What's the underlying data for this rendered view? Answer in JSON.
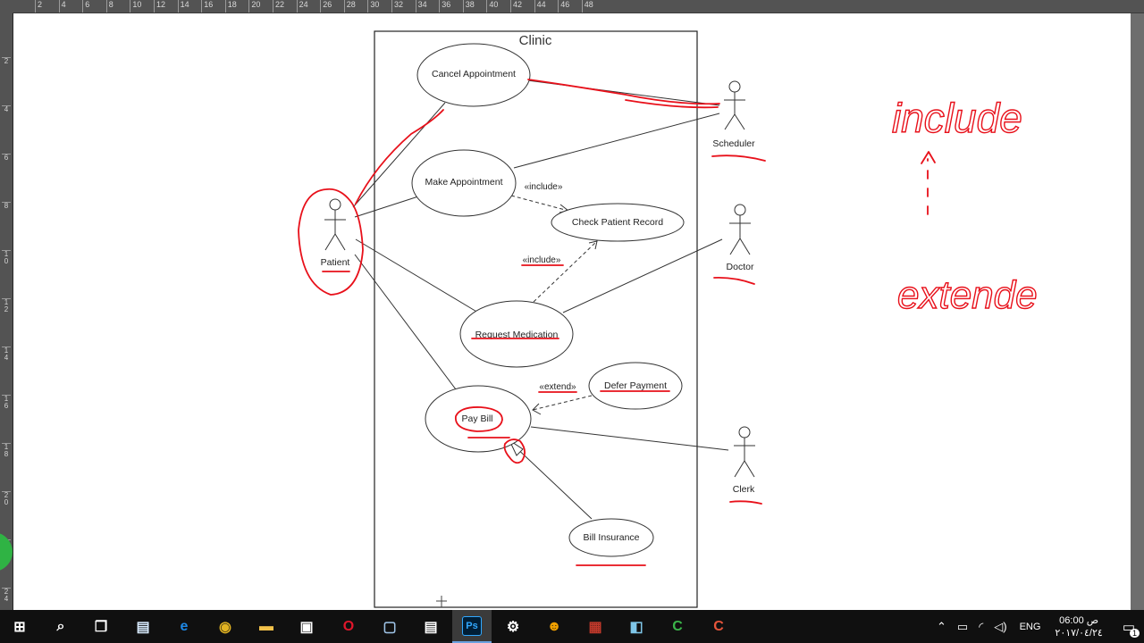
{
  "ruler": {
    "top_ticks": [
      "2",
      "4",
      "6",
      "8",
      "10",
      "12",
      "14",
      "16",
      "18",
      "20",
      "22",
      "24",
      "26",
      "28",
      "30",
      "32",
      "34",
      "36",
      "38",
      "40",
      "42",
      "44",
      "46",
      "48"
    ],
    "left_ticks": [
      "2",
      "4",
      "6",
      "8",
      "1 0",
      "1 2",
      "1 4",
      "1 6",
      "1 8",
      "2 0",
      "2 2",
      "2 4"
    ]
  },
  "diagram": {
    "system_label": "Clinic",
    "actors": {
      "scheduler": "Scheduler",
      "patient": "Patient",
      "doctor": "Doctor",
      "clerk": "Clerk"
    },
    "use_cases": {
      "cancel_appointment": "Cancel Appointment",
      "make_appointment": "Make Appointment",
      "check_patient_record": "Check Patient Record",
      "request_medication": "Request Medication",
      "defer_payment": "Defer Payment",
      "pay_bill": "Pay Bill",
      "bill_insurance": "Bill Insurance"
    },
    "stereotypes": {
      "include_top": "«include»",
      "include_bottom": "«include»",
      "extend": "«extend»"
    }
  },
  "annotations": {
    "word_top": "include",
    "word_bottom": "extende",
    "ink_color": "#e8101a"
  },
  "taskbar": {
    "apps": [
      {
        "icon": "windows-start-icon",
        "glyph": "⊞",
        "color": "#ffffff"
      },
      {
        "icon": "search-icon",
        "glyph": "⌕",
        "color": "#ffffff"
      },
      {
        "icon": "task-view-icon",
        "glyph": "❐",
        "color": "#ffffff"
      },
      {
        "icon": "notepad-icon",
        "glyph": "▤",
        "color": "#d9ecff"
      },
      {
        "icon": "edge-icon",
        "glyph": "e",
        "color": "#1e88e5"
      },
      {
        "icon": "chrome-icon",
        "glyph": "◉",
        "color": "#e3b422"
      },
      {
        "icon": "file-explorer-icon",
        "glyph": "▬",
        "color": "#f3c24a"
      },
      {
        "icon": "store-icon",
        "glyph": "▣",
        "color": "#ffffff"
      },
      {
        "icon": "opera-icon",
        "glyph": "O",
        "color": "#e0162b"
      },
      {
        "icon": "app-window-icon",
        "glyph": "▢",
        "color": "#9ec3e6"
      },
      {
        "icon": "document-viewer-icon",
        "glyph": "▤",
        "color": "#ffffff"
      },
      {
        "icon": "photoshop-icon",
        "glyph": "Ps",
        "color": "#31a8ff"
      },
      {
        "icon": "settings-icon",
        "glyph": "⚙",
        "color": "#ffffff"
      },
      {
        "icon": "avatar-app-icon",
        "glyph": "☻",
        "color": "#f0a000"
      },
      {
        "icon": "archive-icon",
        "glyph": "▦",
        "color": "#c0392b"
      },
      {
        "icon": "notes-icon",
        "glyph": "◧",
        "color": "#7fc6e8"
      },
      {
        "icon": "camtasia-icon",
        "glyph": "C",
        "color": "#3bb54a"
      },
      {
        "icon": "camtasia-recorder-icon",
        "glyph": "C",
        "color": "#e8553b"
      }
    ],
    "language": "ENG",
    "time": "06:00 ص",
    "date": "٢٠١٧/٠٤/٢٤",
    "notification_count": "1"
  }
}
